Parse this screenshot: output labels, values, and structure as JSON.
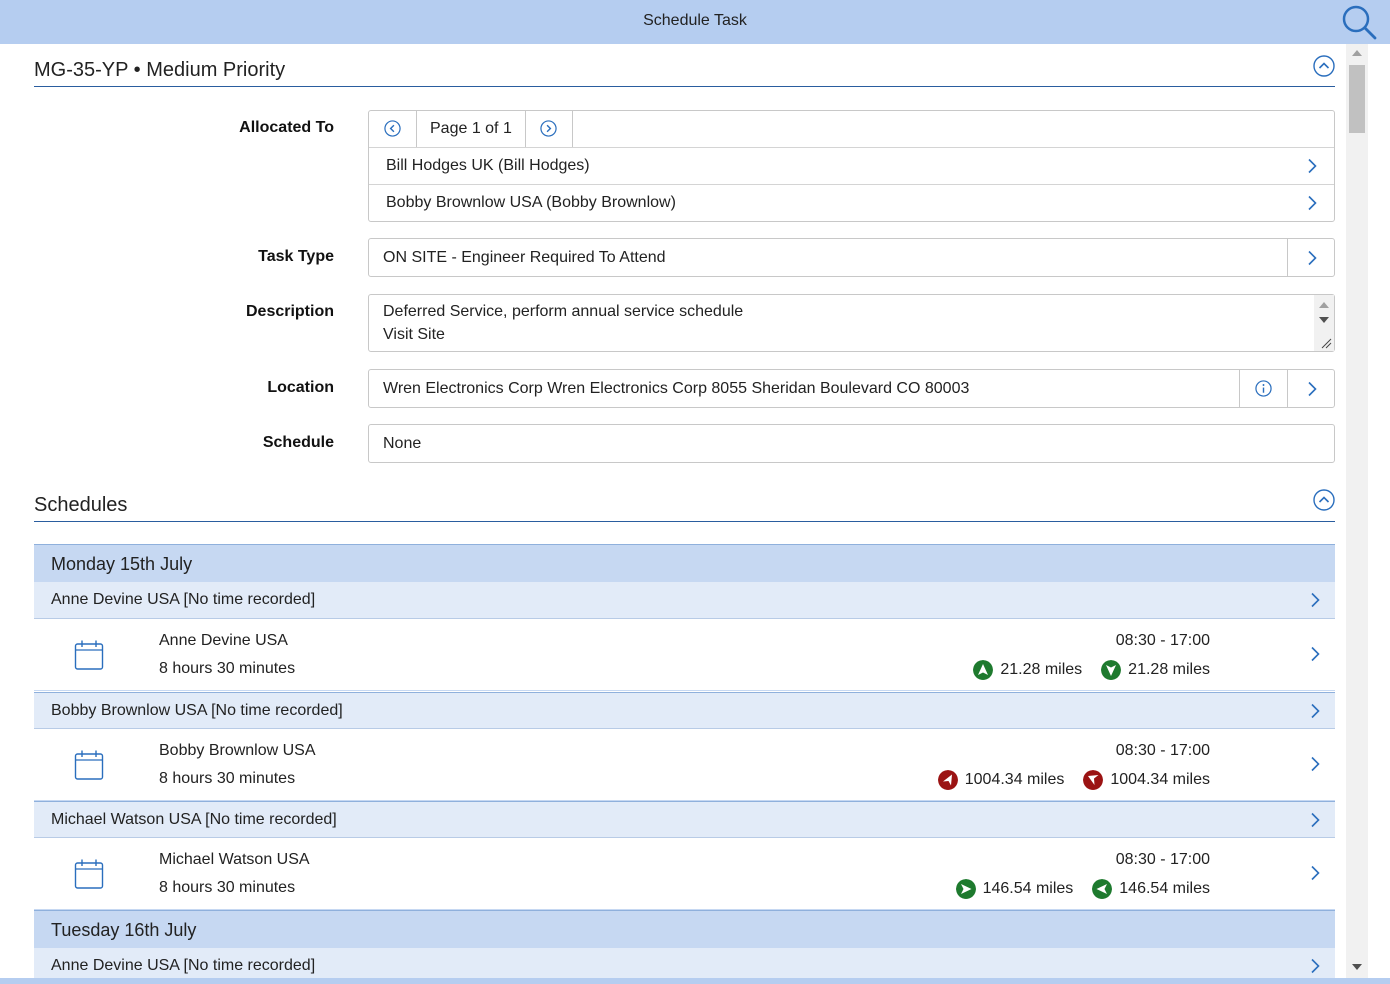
{
  "header": {
    "title": "Schedule Task",
    "search_icon": "search-icon"
  },
  "task_section": {
    "heading": "MG-35-YP • Medium Priority",
    "allocated_to": {
      "label": "Allocated To",
      "pager_text": "Page 1 of 1",
      "items": [
        "Bill Hodges UK (Bill Hodges)",
        "Bobby Brownlow USA (Bobby Brownlow)"
      ]
    },
    "task_type": {
      "label": "Task Type",
      "value": "ON SITE  - Engineer Required To Attend"
    },
    "description": {
      "label": "Description",
      "line1": "Deferred Service, perform annual service schedule",
      "line2": "Visit Site"
    },
    "location": {
      "label": "Location",
      "value": "Wren Electronics Corp Wren Electronics Corp 8055 Sheridan Boulevard   CO 80003"
    },
    "schedule": {
      "label": "Schedule",
      "value": "None"
    }
  },
  "schedules_section": {
    "heading": "Schedules",
    "days": [
      {
        "label": "Monday 15th July",
        "groups": [
          {
            "label": "Anne Devine USA [No time recorded]",
            "entry": {
              "name": "Anne Devine USA",
              "duration": "8 hours 30 minutes",
              "time": "08:30 - 17:00",
              "distance_out": "21.28 miles",
              "distance_back": "21.28 miles",
              "status": "green"
            }
          },
          {
            "label": "Bobby Brownlow USA [No time recorded]",
            "entry": {
              "name": "Bobby Brownlow USA",
              "duration": "8 hours 30 minutes",
              "time": "08:30 - 17:00",
              "distance_out": "1004.34 miles",
              "distance_back": "1004.34 miles",
              "status": "red"
            }
          },
          {
            "label": "Michael Watson USA [No time recorded]",
            "entry": {
              "name": "Michael Watson USA",
              "duration": "8 hours 30 minutes",
              "time": "08:30 - 17:00",
              "distance_out": "146.54 miles",
              "distance_back": "146.54 miles",
              "status": "green"
            }
          }
        ]
      },
      {
        "label": "Tuesday 16th July",
        "groups": [
          {
            "label": "Anne Devine USA [No time recorded]"
          }
        ]
      }
    ]
  },
  "colors": {
    "header_bg": "#b5cdf0",
    "accent": "#2a6ebd",
    "status_green": "#1e7a2e",
    "status_red": "#9b1313"
  }
}
